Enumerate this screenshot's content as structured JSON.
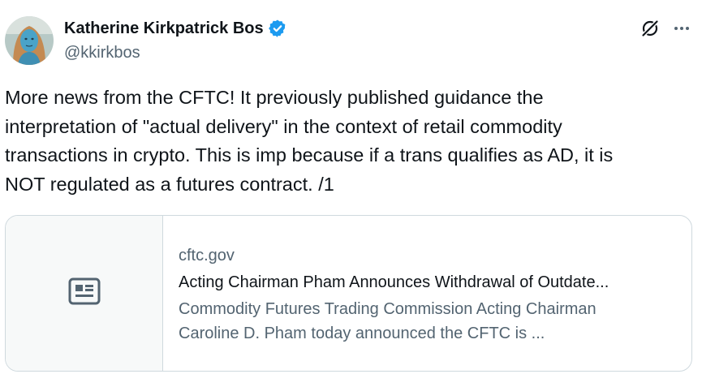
{
  "author": {
    "display_name": "Katherine Kirkpatrick Bos",
    "handle": "@kkirkbos",
    "verified": true,
    "verified_color": "#1d9bf0",
    "avatar_icon": "avatar-photo"
  },
  "actions": {
    "grok_icon": "grok-icon",
    "more_icon": "more-icon"
  },
  "tweet": {
    "text": "More news from the CFTC! It previously published guidance the\ninterpretation of \"actual delivery\" in the context of retail commodity\ntransactions in crypto. This is imp because if a trans qualifies as AD, it is\nNOT regulated as a futures contract. /1"
  },
  "card": {
    "thumbnail_icon": "article-icon",
    "domain": "cftc.gov",
    "title": "Acting Chairman Pham Announces Withdrawal of Outdate...",
    "description": "Commodity Futures Trading Commission Acting Chairman\nCaroline D. Pham today announced the CFTC is ..."
  },
  "colors": {
    "text_primary": "#0f1419",
    "text_secondary": "#536471",
    "border": "#cfd9de",
    "card_thumb_bg": "#f7f9f9"
  }
}
